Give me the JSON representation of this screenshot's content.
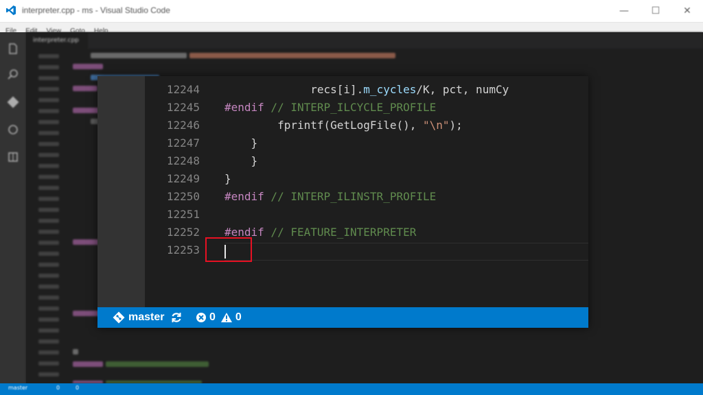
{
  "window": {
    "title": "interpreter.cpp - ms - Visual Studio Code",
    "minimize_glyph": "—",
    "maximize_glyph": "☐",
    "close_glyph": "✕"
  },
  "menu": [
    "File",
    "Edit",
    "View",
    "Goto",
    "Help"
  ],
  "background_editor": {
    "tab_label": "interpreter.cpp"
  },
  "zoomed_editor": {
    "lines": [
      {
        "number": "12244",
        "indent": "             ",
        "parts": [
          {
            "t": "recs[i].",
            "c": "plain"
          },
          {
            "t": "m_cycles",
            "c": "mem"
          },
          {
            "t": "/K, pct, numCy",
            "c": "plain"
          }
        ]
      },
      {
        "number": "12245",
        "indent": "",
        "parts": [
          {
            "t": "#endif",
            "c": "kw"
          },
          {
            "t": " // INTERP_ILCYCLE_PROFILE",
            "c": "cm"
          }
        ]
      },
      {
        "number": "12246",
        "indent": "        ",
        "parts": [
          {
            "t": "fprintf(GetLogFile(), ",
            "c": "plain"
          },
          {
            "t": "\"\\n\"",
            "c": "str"
          },
          {
            "t": ");",
            "c": "plain"
          }
        ]
      },
      {
        "number": "12247",
        "indent": "    ",
        "parts": [
          {
            "t": "}",
            "c": "plain"
          }
        ]
      },
      {
        "number": "12248",
        "indent": "    ",
        "parts": [
          {
            "t": "}",
            "c": "plain"
          }
        ]
      },
      {
        "number": "12249",
        "indent": "",
        "parts": [
          {
            "t": "}",
            "c": "plain"
          }
        ]
      },
      {
        "number": "12250",
        "indent": "",
        "parts": [
          {
            "t": "#endif",
            "c": "kw"
          },
          {
            "t": " // INTERP_ILINSTR_PROFILE",
            "c": "cm"
          }
        ]
      },
      {
        "number": "12251",
        "indent": "",
        "parts": []
      },
      {
        "number": "12252",
        "indent": "",
        "parts": [
          {
            "t": "#endif",
            "c": "kw"
          },
          {
            "t": " // FEATURE_INTERPRETER",
            "c": "cm"
          }
        ]
      },
      {
        "number": "12253",
        "indent": "",
        "parts": []
      }
    ],
    "highlighted_line": "12253"
  },
  "status_bar": {
    "branch": "master",
    "errors": "0",
    "warnings": "0"
  },
  "colors": {
    "accent": "#007acc",
    "highlight_box": "#e81123"
  }
}
